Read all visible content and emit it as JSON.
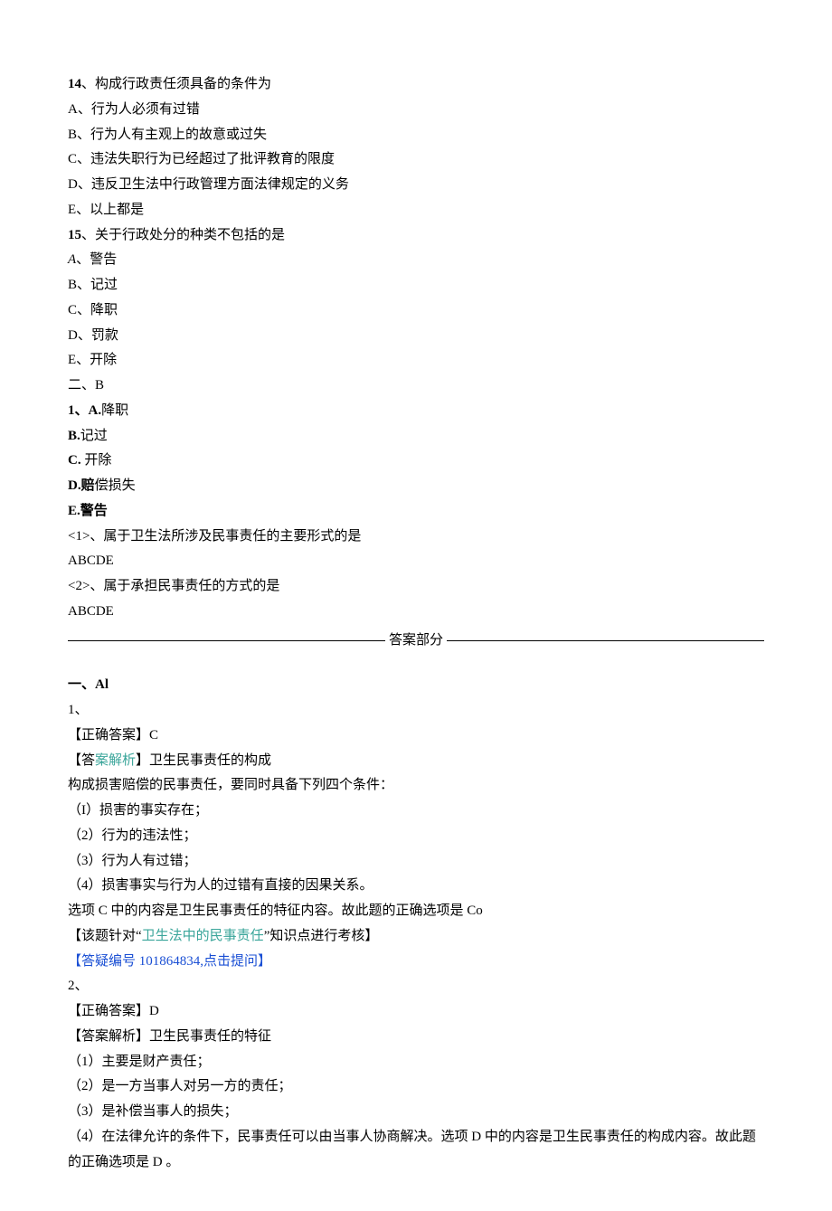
{
  "q14": {
    "num": "14",
    "sep": "、",
    "stem": "构成行政责任须具备的条件为",
    "options": [
      "A、行为人必须有过错",
      "B、行为人有主观上的故意或过失",
      "C、违法失职行为已经超过了批评教育的限度",
      "D、违反卫生法中行政管理方面法律规定的义务",
      "E、以上都是"
    ]
  },
  "q15": {
    "num": "15",
    "sep": "、",
    "stem": "关于行政处分的种类不包括的是",
    "options": [
      {
        "label_a": "A",
        "sep": "、",
        "text": "警告"
      },
      {
        "label_a": "B、记过"
      },
      {
        "label_a": "C、降职"
      },
      {
        "label_a": "D、罚款"
      },
      {
        "label_a": "E、开除"
      }
    ]
  },
  "section2": {
    "heading": "二、B",
    "q1": {
      "num": "1",
      "sep": "、",
      "a": {
        "label": "A.",
        "text": "降职"
      },
      "b": {
        "label": "B.",
        "text": "记过"
      },
      "c": {
        "label": "C.",
        "text": " 开除"
      },
      "d": {
        "label": "D.",
        "text": "赔",
        "rest": "偿损失"
      },
      "e": {
        "label": "E.警告"
      }
    },
    "subs": [
      {
        "tag": "<1>、",
        "text": "属于卫生法所涉及民事责任的主要形式的是",
        "choices": "ABCDE"
      },
      {
        "tag": "<2>、",
        "text": "属于承担民事责任的方式的是",
        "choices": "ABCDE"
      }
    ]
  },
  "answers": {
    "heading": "答案部分",
    "section1": "一、Al",
    "a1": {
      "num": "1、",
      "correct_label": "【正确答案】",
      "correct_value": "C",
      "analysis_label_l": "【答",
      "analysis_label_mid": "案解析",
      "analysis_label_r": "】",
      "analysis_title": "卫生民事责任的构成",
      "line0": "构成损害赔偿的民事责任，要同时具备下列四个条件：",
      "points": [
        "（I）损害的事实存在；",
        "（2）行为的违法性；",
        "（3）行为人有过错；",
        "（4）损害事实与行为人的过错有直接的因果关系。"
      ],
      "conclusion": "选项 C 中的内容是卫生民事责任的特征内容。故此题的正确选项是 Co",
      "topic_l": "【该题针对“",
      "topic_mid": "卫生法中的民事责任",
      "topic_r": "”知识点进行考核】",
      "qid_line": "【答疑编号 101864834,点击提问】"
    },
    "a2": {
      "num": "2、",
      "correct_label": "【正确答案】",
      "correct_value": "D",
      "analysis_label": "【答案解析】",
      "analysis_title": "卫生民事责任的特征",
      "points": [
        "（1）主要是财产责任；",
        "（2）是一方当事人对另一方的责任；",
        "（3）是补偿当事人的损失；",
        "（4）在法律允许的条件下，民事责任可以由当事人协商解决。选项 D 中的内容是卫生民事责任的构成内容。故此题的正确选项是 D 。"
      ]
    }
  }
}
